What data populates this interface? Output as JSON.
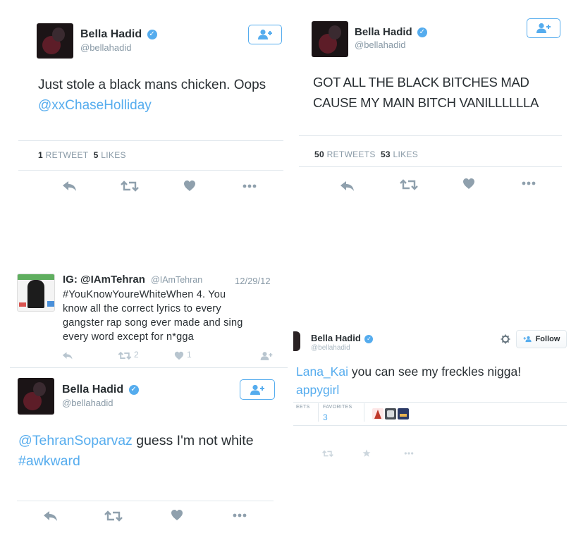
{
  "tweet1": {
    "name": "Bella Hadid",
    "handle": "@bellahadid",
    "text_plain": "Just stole a black mans chicken. Oops",
    "text_mention": "@xxChaseHolliday",
    "retweets_count": "1",
    "retweets_label": "RETWEET",
    "likes_count": "5",
    "likes_label": "LIKES"
  },
  "tweet2": {
    "name": "Bella Hadid",
    "handle": "@bellahadid",
    "text_line1": "GOT ALL THE BLACK BITCHES MAD",
    "text_line2": "CAUSE MY MAIN BITCH VANILLLLLLA",
    "retweets_count": "50",
    "retweets_label": "RETWEETS",
    "likes_count": "53",
    "likes_label": "LIKES"
  },
  "tweet3": {
    "name": "IG: @IAmTehran",
    "handle": "@IAmTehran",
    "date": "12/29/12",
    "line1": "#YouKnowYoureWhiteWhen  4.  You",
    "line2": "know all the correct lyrics to every",
    "line3": "gangster rap song ever made and sing",
    "line4": "every word except for n*gga",
    "retweet_count": "2",
    "like_count": "1"
  },
  "tweet4": {
    "name": "Bella Hadid",
    "handle": "@bellahadid",
    "mention": "@TehranSoparvaz",
    "text": " guess I'm not white",
    "hashtag": "#awkward"
  },
  "tweet5": {
    "name": "Bella Hadid",
    "handle": "@bellahadid",
    "follow_label": "Follow",
    "mention_fragment": "Lana_Kai",
    "text": " you can see my freckles nigga!",
    "line2_fragment": "appygirl",
    "retweets_label_fragment": "EETS",
    "favorites_label": "FAVORITES",
    "favorites_count": "3"
  },
  "colors": {
    "accent": "#55acee",
    "text": "#292f33",
    "muted": "#8899a6",
    "action_icon": "#a5b5c2",
    "divider": "#e1e8ed"
  },
  "icons": [
    "reply-icon",
    "retweet-icon",
    "like-icon",
    "more-icon",
    "follow-person-icon",
    "gear-icon",
    "star-icon",
    "verified-icon"
  ]
}
